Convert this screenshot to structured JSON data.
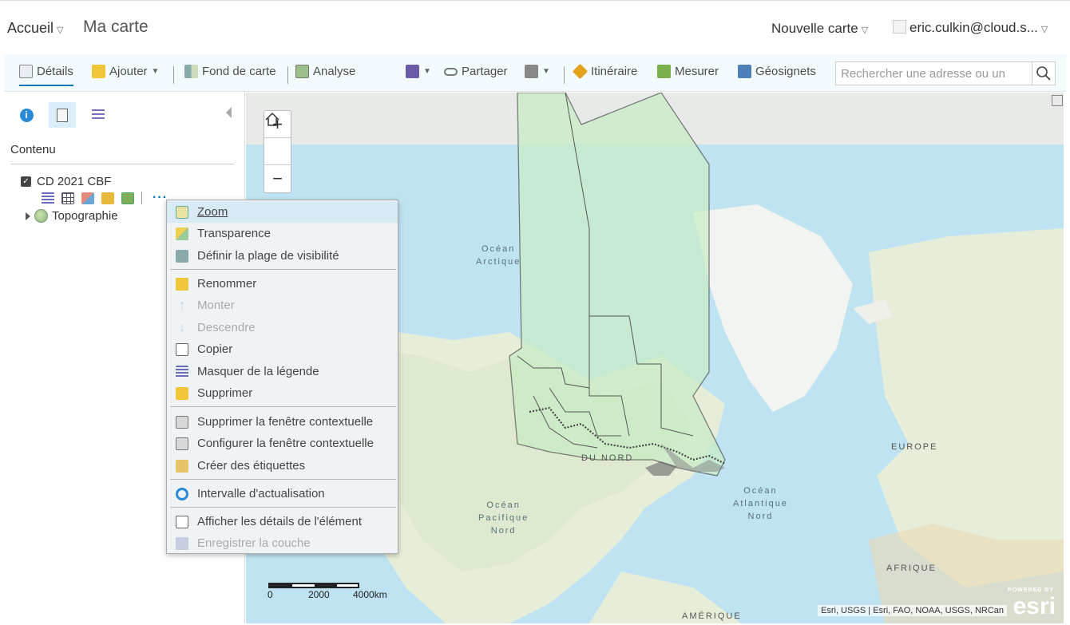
{
  "header": {
    "home_label": "Accueil",
    "map_title": "Ma carte",
    "new_map_label": "Nouvelle carte",
    "user_label": "eric.culkin@cloud.s..."
  },
  "toolbar": {
    "details": "Détails",
    "add": "Ajouter",
    "basemap": "Fond de carte",
    "analysis": "Analyse",
    "share": "Partager",
    "directions": "Itinéraire",
    "measure": "Mesurer",
    "bookmarks": "Géosignets",
    "search_placeholder": "Rechercher une adresse ou un"
  },
  "sidebar": {
    "heading": "Contenu",
    "layers": [
      {
        "name": "CD 2021 CBF",
        "checked": true
      },
      {
        "name": "Topographie"
      }
    ]
  },
  "context_menu": {
    "items": [
      {
        "label": "Zoom",
        "icon": "zoom-icon",
        "state": "highlighted"
      },
      {
        "label": "Transparence",
        "icon": "transparency-icon"
      },
      {
        "label": "Définir la plage de visibilité",
        "icon": "visibility-range-icon"
      },
      {
        "label": "Renommer",
        "icon": "rename-icon"
      },
      {
        "label": "Monter",
        "icon": "arrow-up-icon",
        "state": "disabled"
      },
      {
        "label": "Descendre",
        "icon": "arrow-down-icon",
        "state": "disabled"
      },
      {
        "label": "Copier",
        "icon": "copy-icon"
      },
      {
        "label": "Masquer de la légende",
        "icon": "hide-legend-icon"
      },
      {
        "label": "Supprimer",
        "icon": "delete-icon"
      },
      {
        "label": "Supprimer la fenêtre contextuelle",
        "icon": "remove-popup-icon"
      },
      {
        "label": "Configurer la fenêtre contextuelle",
        "icon": "configure-popup-icon"
      },
      {
        "label": "Créer des étiquettes",
        "icon": "labels-icon"
      },
      {
        "label": "Intervalle d'actualisation",
        "icon": "refresh-icon"
      },
      {
        "label": "Afficher les détails de l'élément",
        "icon": "item-details-icon"
      },
      {
        "label": "Enregistrer la couche",
        "icon": "save-layer-icon",
        "state": "disabled"
      }
    ]
  },
  "map": {
    "labels": {
      "arctic": "Océan\nArctique",
      "europe": "EUROPE",
      "atlantic": "Océan\nAtlantique\nNord",
      "pacific": "Océan\nPacifique\nNord",
      "africa": "AFRIQUE",
      "south_america": "AMÉRIQUE",
      "north": "DU NORD"
    },
    "scale": {
      "s0": "0",
      "s1": "2000",
      "s2": "4000km"
    },
    "attribution": "Esri, USGS | Esri, FAO, NOAA, USGS, NRCan",
    "powered_by": "POWERED BY",
    "esri": "esri"
  },
  "colors": {
    "accent": "#0079c1",
    "map_water": "#bfe3f2",
    "map_land": "#e6eed9",
    "layer_fill": "#c9ecc6",
    "menu_bg": "#f0f3f5"
  }
}
